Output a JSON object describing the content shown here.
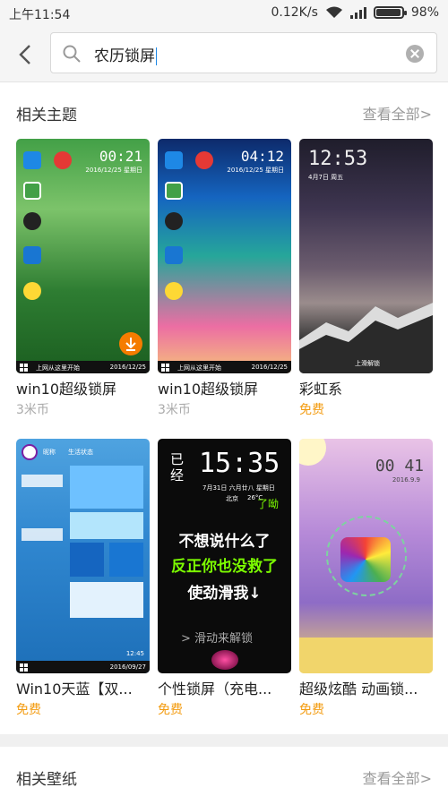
{
  "status_bar": {
    "time": "上午11:54",
    "speed": "0.12K/s",
    "battery": "98%",
    "battery_level": 0.98
  },
  "search": {
    "query": "农历锁屏"
  },
  "sections": [
    {
      "title": "相关主题",
      "more": "查看全部>"
    },
    {
      "title": "相关壁纸",
      "more": "查看全部>"
    }
  ],
  "themes": [
    {
      "name": "win10超级锁屏",
      "price": "3米币",
      "clock": "00:21",
      "date": "2016/12/25 星期日",
      "taskbar": "上网从这里开始",
      "tray_date": "2016/12/25"
    },
    {
      "name": "win10超级锁屏",
      "price": "3米币",
      "clock": "04:12",
      "date": "2016/12/25 星期日",
      "taskbar": "上网从这里开始",
      "tray_date": "2016/12/25"
    },
    {
      "name": "彩虹系",
      "price": "免费",
      "clock": "12:53",
      "date": "4月7日 周五",
      "bottom": "上滑解锁"
    },
    {
      "name": "Win10天蓝【双...",
      "price": "免费",
      "user": "昵称",
      "status": "生活状态",
      "clock": "12:45",
      "date": "2016/09/27"
    },
    {
      "name": "个性锁屏（充电...",
      "price": "免费",
      "clock": "15:35",
      "prefix": "已经",
      "date": "7月31日 六月廿八 星期日",
      "city": "北京",
      "temp": "26°C",
      "side": "了呦",
      "line1": "不想说什么了",
      "line2": "反正你也没救了",
      "line3": "使劲滑我↓",
      "unlock": "滑动来解锁"
    },
    {
      "name": "超级炫酷 动画锁...",
      "price": "免费",
      "clock": "00 41",
      "date": "2016.9.9"
    }
  ]
}
